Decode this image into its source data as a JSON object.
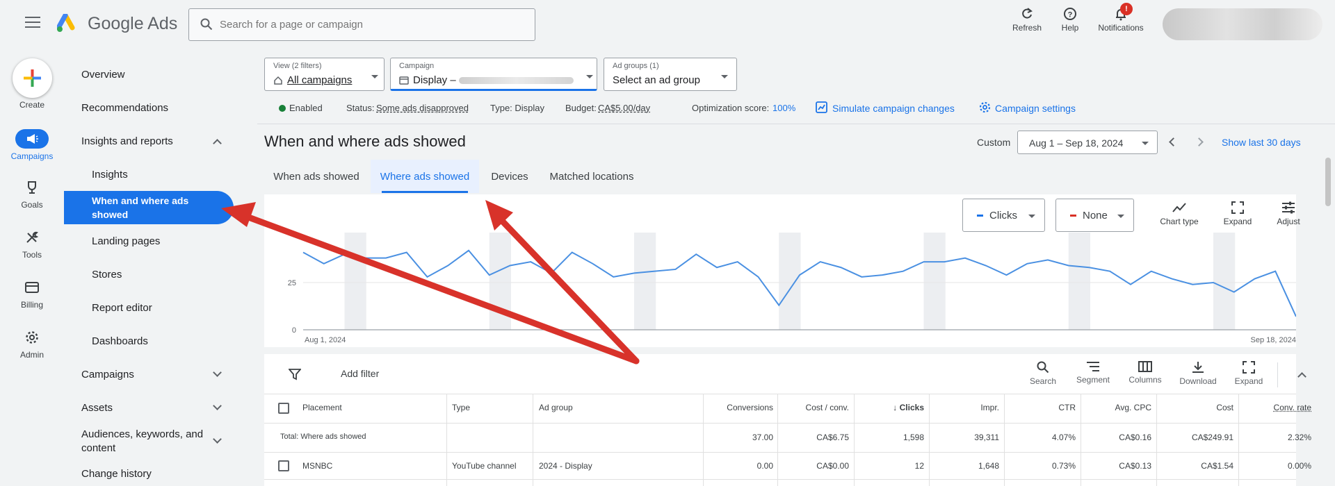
{
  "app": {
    "name": "Google Ads"
  },
  "search": {
    "placeholder": "Search for a page or campaign"
  },
  "top_actions": [
    {
      "label": "Refresh",
      "icon": "refresh-icon"
    },
    {
      "label": "Help",
      "icon": "help-icon"
    },
    {
      "label": "Notifications",
      "icon": "bell-icon",
      "badge": "!"
    }
  ],
  "rail": [
    {
      "label": "Create",
      "icon": "plus-icon"
    },
    {
      "label": "Campaigns",
      "icon": "megaphone-icon",
      "active": true
    },
    {
      "label": "Goals",
      "icon": "trophy-icon"
    },
    {
      "label": "Tools",
      "icon": "tools-icon"
    },
    {
      "label": "Billing",
      "icon": "card-icon"
    },
    {
      "label": "Admin",
      "icon": "gear-icon"
    }
  ],
  "sidenav": {
    "items": [
      "Overview",
      "Recommendations",
      "Insights and reports",
      "Insights",
      "When and where ads showed",
      "Landing pages",
      "Stores",
      "Report editor",
      "Dashboards",
      "Campaigns",
      "Assets",
      "Audiences, keywords, and content",
      "Change history"
    ]
  },
  "filters": {
    "view": {
      "label": "View (2 filters)",
      "value": "All campaigns"
    },
    "campaign": {
      "label": "Campaign",
      "value": "Display –"
    },
    "adgroups": {
      "label": "Ad groups (1)",
      "value": "Select an ad group"
    }
  },
  "status": {
    "enabled": "Enabled",
    "status_label": "Status:",
    "status_value": "Some ads disapproved",
    "type": "Type: Display",
    "budget_label": "Budget:",
    "budget_value": "CA$5.00/day",
    "opt_label": "Optimization score:",
    "opt_value": "100%",
    "simulate": "Simulate campaign changes",
    "settings": "Campaign settings"
  },
  "page": {
    "title": "When and where ads showed",
    "range_label": "Custom",
    "date_range": "Aug 1 – Sep 18, 2024",
    "show_last": "Show last 30 days"
  },
  "tabs": [
    "When ads showed",
    "Where ads showed",
    "Devices",
    "Matched locations"
  ],
  "chart_controls": {
    "metric1": "Clicks",
    "metric2": "None",
    "buttons": [
      "Chart type",
      "Expand",
      "Adjust"
    ],
    "colors": {
      "metric1": "#1a73e8",
      "metric2": "#d93025"
    }
  },
  "chart_data": {
    "type": "line",
    "xlabel_start": "Aug 1, 2024",
    "xlabel_end": "Sep 18, 2024",
    "yticks": [
      "0",
      "25"
    ],
    "ylim": [
      0,
      50
    ],
    "series": [
      {
        "values": [
          41,
          35,
          40,
          38,
          38,
          41,
          28,
          34,
          42,
          29,
          34,
          36,
          30,
          41,
          35,
          28,
          30,
          31,
          32,
          40,
          33,
          36,
          28,
          13,
          29,
          36,
          33,
          28,
          29,
          31,
          36,
          36,
          38,
          34,
          29,
          35,
          37,
          34,
          33,
          31,
          24,
          31,
          27,
          24,
          25,
          20,
          27,
          31,
          7
        ],
        "color": "#4a90e2"
      }
    ],
    "weekend_bands": true
  },
  "table_toolbar": {
    "add_filter": "Add filter",
    "buttons": [
      "Search",
      "Segment",
      "Columns",
      "Download",
      "Expand"
    ]
  },
  "table": {
    "columns": [
      "Placement",
      "Type",
      "Ad group",
      "Conversions",
      "Cost / conv.",
      "Clicks",
      "Impr.",
      "CTR",
      "Avg. CPC",
      "Cost",
      "Conv. rate"
    ],
    "total_row": [
      "Total: Where ads showed",
      "",
      "",
      "37.00",
      "CA$6.75",
      "1,598",
      "39,311",
      "4.07%",
      "CA$0.16",
      "CA$249.91",
      "2.32%"
    ],
    "rows": [
      [
        "MSNBC",
        "YouTube channel",
        "2024 - Display",
        "0.00",
        "CA$0.00",
        "12",
        "1,648",
        "0.73%",
        "CA$0.13",
        "CA$1.54",
        "0.00%"
      ]
    ]
  },
  "annotation_color": "#d8322a"
}
